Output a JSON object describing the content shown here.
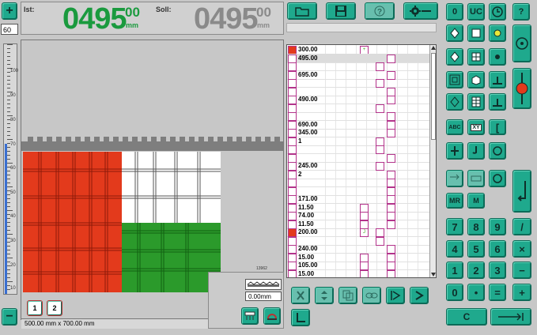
{
  "header": {
    "ist_label": "Ist:",
    "ist_value": "0495",
    "ist_decimals": "00",
    "ist_unit": "mm",
    "soll_label": "Soll:",
    "soll_value": "0495",
    "soll_decimals": "00",
    "soll_unit": "mm",
    "plus_label": "+",
    "minus_label": "−",
    "field_value": "60"
  },
  "ruler": {
    "labels": [
      "100",
      "90",
      "80",
      "70",
      "60",
      "50",
      "40",
      "30",
      "20",
      "10"
    ],
    "fill_fraction": 0.6
  },
  "workpiece": {
    "dimensions": "500.00 mm x  700.00 mm",
    "small_label": "13962",
    "offset_value": "0.00mm",
    "page_buttons": [
      "1",
      "2"
    ]
  },
  "colors": {
    "red": "#e33a1c",
    "green": "#2b9a2b",
    "accent": "#1fa98d",
    "ist": "#1a9a3e",
    "soll": "#8a8a8a"
  },
  "table": {
    "rows": [
      {
        "icon": "red",
        "value": "300.00"
      },
      {
        "icon": "",
        "value": "495.00"
      },
      {
        "icon": "",
        "value": ""
      },
      {
        "icon": "",
        "value": "695.00"
      },
      {
        "icon": "",
        "value": ""
      },
      {
        "icon": "",
        "value": ""
      },
      {
        "icon": "",
        "value": "490.00"
      },
      {
        "icon": "",
        "value": ""
      },
      {
        "icon": "",
        "value": ""
      },
      {
        "icon": "",
        "value": "690.00"
      },
      {
        "icon": "",
        "value": "345.00"
      },
      {
        "icon": "",
        "value": "1"
      },
      {
        "icon": "",
        "value": ""
      },
      {
        "icon": "",
        "value": ""
      },
      {
        "icon": "",
        "value": "245.00"
      },
      {
        "icon": "",
        "value": "2"
      },
      {
        "icon": "",
        "value": ""
      },
      {
        "icon": "",
        "value": ""
      },
      {
        "icon": "",
        "value": "171.00"
      },
      {
        "icon": "",
        "value": "11.50"
      },
      {
        "icon": "",
        "value": "74.00"
      },
      {
        "icon": "",
        "value": "11.50"
      },
      {
        "icon": "red",
        "value": "200.00"
      },
      {
        "icon": "",
        "value": ""
      },
      {
        "icon": "",
        "value": "240.00"
      },
      {
        "icon": "",
        "value": "15.00"
      },
      {
        "icon": "",
        "value": "105.00"
      },
      {
        "icon": "",
        "value": "15.00"
      }
    ]
  },
  "keypad": {
    "top": [
      "0",
      "UC",
      "⊙",
      "?"
    ],
    "row_abc": [
      "ABC",
      "XY",
      "["
    ],
    "mr": "MR",
    "m": "M",
    "digits": [
      [
        "7",
        "8",
        "9",
        "/"
      ],
      [
        "4",
        "5",
        "6",
        "×"
      ],
      [
        "1",
        "2",
        "3",
        "−"
      ],
      [
        "0",
        "•",
        "=",
        "+"
      ]
    ],
    "clear": "C"
  }
}
